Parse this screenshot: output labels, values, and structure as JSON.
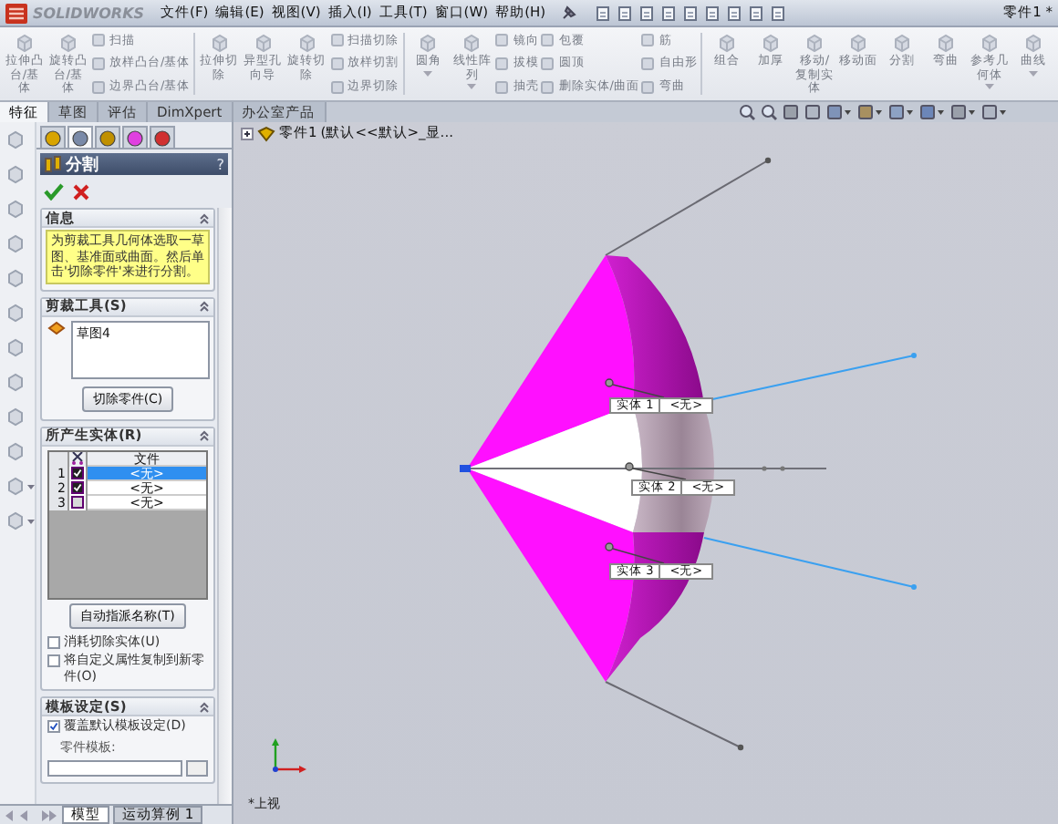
{
  "titlebar": {
    "logo": "SOLIDWORKS",
    "menu": [
      "文件(F)",
      "编辑(E)",
      "视图(V)",
      "插入(I)",
      "工具(T)",
      "窗口(W)",
      "帮助(H)"
    ],
    "document": "零件1 *"
  },
  "ribbon": {
    "disabled": true,
    "items": [
      {
        "kind": "large",
        "label": "拉伸凸台/基体",
        "dropdown": false
      },
      {
        "kind": "large",
        "label": "旋转凸台/基体",
        "dropdown": false
      },
      {
        "kind": "stack",
        "items": [
          "扫描",
          "放样凸台/基体",
          "边界凸台/基体"
        ]
      },
      {
        "kind": "separator"
      },
      {
        "kind": "large",
        "label": "拉伸切除",
        "dropdown": false
      },
      {
        "kind": "large",
        "label": "异型孔向导",
        "dropdown": false
      },
      {
        "kind": "large",
        "label": "旋转切除",
        "dropdown": false
      },
      {
        "kind": "stack",
        "items": [
          "扫描切除",
          "放样切割",
          "边界切除"
        ]
      },
      {
        "kind": "separator"
      },
      {
        "kind": "large",
        "label": "圆角",
        "dropdown": true
      },
      {
        "kind": "large",
        "label": "线性阵列",
        "dropdown": true
      },
      {
        "kind": "stack",
        "items": [
          "镜向",
          "拔模",
          "抽壳"
        ]
      },
      {
        "kind": "stack",
        "items": [
          "包覆",
          "圆顶",
          "删除实体/曲面"
        ]
      },
      {
        "kind": "stack",
        "items": [
          "筋",
          "自由形",
          "弯曲"
        ]
      },
      {
        "kind": "separator"
      },
      {
        "kind": "large",
        "label": "组合",
        "dropdown": false
      },
      {
        "kind": "large",
        "label": "加厚",
        "dropdown": false
      },
      {
        "kind": "large",
        "label": "移动/复制实体",
        "dropdown": false
      },
      {
        "kind": "large",
        "label": "移动面",
        "dropdown": false
      },
      {
        "kind": "large",
        "label": "分割",
        "dropdown": false
      },
      {
        "kind": "large",
        "label": "弯曲",
        "dropdown": false
      },
      {
        "kind": "large",
        "label": "参考几何体",
        "dropdown": true
      },
      {
        "kind": "large",
        "label": "曲线",
        "dropdown": true
      }
    ]
  },
  "command_tabs": [
    {
      "label": "特征",
      "selected": true
    },
    {
      "label": "草图",
      "selected": false
    },
    {
      "label": "评估",
      "selected": false
    },
    {
      "label": "DimXpert",
      "selected": false
    },
    {
      "label": "办公室产品",
      "selected": false
    }
  ],
  "property_manager": {
    "panel_tabs": [
      {
        "selected": false
      },
      {
        "selected": true
      },
      {
        "selected": false
      },
      {
        "selected": false
      },
      {
        "selected": false
      }
    ],
    "title": "分割",
    "help": "?",
    "info": {
      "heading": "信息",
      "text": "为剪裁工具几何体选取一草图、基准面或曲面。然后单击'切除零件'来进行分割。"
    },
    "trim_tools": {
      "heading": "剪裁工具(S)",
      "items": [
        "草图4"
      ],
      "button": "切除零件(C)"
    },
    "bodies": {
      "heading": "所产生实体(R)",
      "column": "文件",
      "rows": [
        {
          "number": "1",
          "checked": true,
          "file": "<无>",
          "selected": true
        },
        {
          "number": "2",
          "checked": true,
          "file": "<无>",
          "selected": false
        },
        {
          "number": "3",
          "checked": false,
          "file": "<无>",
          "selected": false
        }
      ],
      "button": "自动指派名称(T)"
    },
    "options": [
      {
        "label": "消耗切除实体(U)",
        "checked": false
      },
      {
        "label": "将自定义属性复制到新零件(O)",
        "checked": false
      }
    ],
    "template": {
      "heading": "模板设定(S)",
      "override": {
        "label": "覆盖默认模板设定(D)",
        "checked": true
      },
      "field_label": "零件模板:"
    }
  },
  "graphics": {
    "part": "零件1",
    "config": "(默认<<默认>_显...",
    "callouts": [
      {
        "label": "实体 1",
        "file": "<无>"
      },
      {
        "label": "实体 2",
        "file": "<无>"
      },
      {
        "label": "实体 3",
        "file": "<无>"
      }
    ],
    "view_label": "*上视"
  },
  "bottom_tabs": [
    {
      "label": "模型",
      "selected": true
    },
    {
      "label": "运动算例 1",
      "selected": false
    }
  ]
}
